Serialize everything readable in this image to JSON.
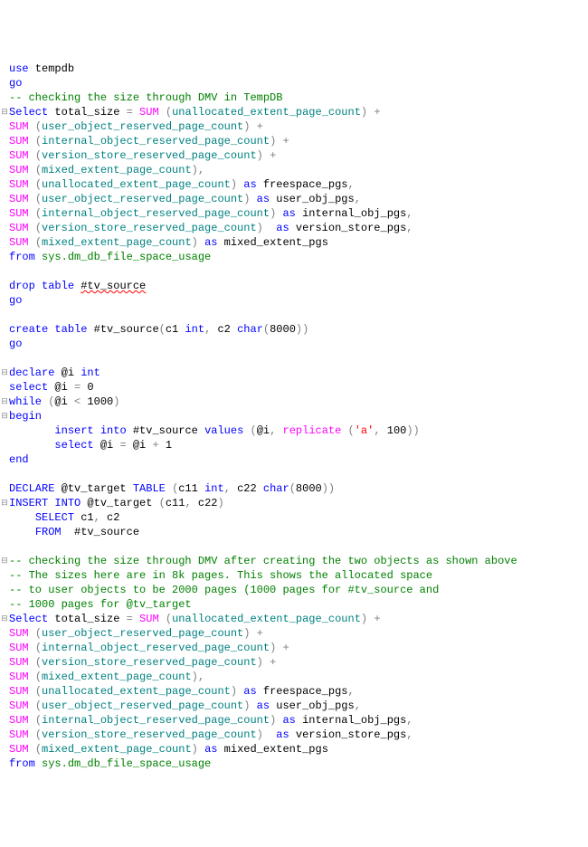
{
  "lines": [
    {
      "gutter": "",
      "parts": [
        [
          "blue",
          "use"
        ],
        [
          "black",
          " tempdb"
        ]
      ]
    },
    {
      "gutter": "",
      "parts": [
        [
          "blue",
          "go"
        ]
      ]
    },
    {
      "gutter": "",
      "parts": [
        [
          "green",
          "-- checking the size through DMV in TempDB"
        ]
      ]
    },
    {
      "gutter": "⊟",
      "parts": [
        [
          "blue",
          "Select"
        ],
        [
          "black",
          " total_size "
        ],
        [
          "gray",
          "="
        ],
        [
          "black",
          " "
        ],
        [
          "magenta",
          "SUM"
        ],
        [
          "black",
          " "
        ],
        [
          "gray",
          "("
        ],
        [
          "teal",
          "unallocated_extent_page_count"
        ],
        [
          "gray",
          ")"
        ],
        [
          "black",
          " "
        ],
        [
          "gray",
          "+"
        ]
      ]
    },
    {
      "gutter": "",
      "parts": [
        [
          "magenta",
          "SUM"
        ],
        [
          "black",
          " "
        ],
        [
          "gray",
          "("
        ],
        [
          "teal",
          "user_object_reserved_page_count"
        ],
        [
          "gray",
          ")"
        ],
        [
          "black",
          " "
        ],
        [
          "gray",
          "+"
        ]
      ]
    },
    {
      "gutter": "",
      "parts": [
        [
          "magenta",
          "SUM"
        ],
        [
          "black",
          " "
        ],
        [
          "gray",
          "("
        ],
        [
          "teal",
          "internal_object_reserved_page_count"
        ],
        [
          "gray",
          ")"
        ],
        [
          "black",
          " "
        ],
        [
          "gray",
          "+"
        ]
      ]
    },
    {
      "gutter": "",
      "parts": [
        [
          "magenta",
          "SUM"
        ],
        [
          "black",
          " "
        ],
        [
          "gray",
          "("
        ],
        [
          "teal",
          "version_store_reserved_page_count"
        ],
        [
          "gray",
          ")"
        ],
        [
          "black",
          " "
        ],
        [
          "gray",
          "+"
        ]
      ]
    },
    {
      "gutter": "",
      "parts": [
        [
          "magenta",
          "SUM"
        ],
        [
          "black",
          " "
        ],
        [
          "gray",
          "("
        ],
        [
          "teal",
          "mixed_extent_page_count"
        ],
        [
          "gray",
          ")"
        ],
        [
          "gray",
          ","
        ]
      ]
    },
    {
      "gutter": "",
      "parts": [
        [
          "magenta",
          "SUM"
        ],
        [
          "black",
          " "
        ],
        [
          "gray",
          "("
        ],
        [
          "teal",
          "unallocated_extent_page_count"
        ],
        [
          "gray",
          ")"
        ],
        [
          "black",
          " "
        ],
        [
          "blue",
          "as"
        ],
        [
          "black",
          " freespace_pgs"
        ],
        [
          "gray",
          ","
        ]
      ]
    },
    {
      "gutter": "",
      "parts": [
        [
          "magenta",
          "SUM"
        ],
        [
          "black",
          " "
        ],
        [
          "gray",
          "("
        ],
        [
          "teal",
          "user_object_reserved_page_count"
        ],
        [
          "gray",
          ")"
        ],
        [
          "black",
          " "
        ],
        [
          "blue",
          "as"
        ],
        [
          "black",
          " user_obj_pgs"
        ],
        [
          "gray",
          ","
        ]
      ]
    },
    {
      "gutter": "",
      "parts": [
        [
          "magenta",
          "SUM"
        ],
        [
          "black",
          " "
        ],
        [
          "gray",
          "("
        ],
        [
          "teal",
          "internal_object_reserved_page_count"
        ],
        [
          "gray",
          ")"
        ],
        [
          "black",
          " "
        ],
        [
          "blue",
          "as"
        ],
        [
          "black",
          " internal_obj_pgs"
        ],
        [
          "gray",
          ","
        ]
      ]
    },
    {
      "gutter": "",
      "parts": [
        [
          "magenta",
          "SUM"
        ],
        [
          "black",
          " "
        ],
        [
          "gray",
          "("
        ],
        [
          "teal",
          "version_store_reserved_page_count"
        ],
        [
          "gray",
          ")"
        ],
        [
          "black",
          "  "
        ],
        [
          "blue",
          "as"
        ],
        [
          "black",
          " version_store_pgs"
        ],
        [
          "gray",
          ","
        ]
      ]
    },
    {
      "gutter": "",
      "parts": [
        [
          "magenta",
          "SUM"
        ],
        [
          "black",
          " "
        ],
        [
          "gray",
          "("
        ],
        [
          "teal",
          "mixed_extent_page_count"
        ],
        [
          "gray",
          ")"
        ],
        [
          "black",
          " "
        ],
        [
          "blue",
          "as"
        ],
        [
          "black",
          " mixed_extent_pgs"
        ]
      ]
    },
    {
      "gutter": "",
      "parts": [
        [
          "blue",
          "from"
        ],
        [
          "black",
          " "
        ],
        [
          "green",
          "sys.dm_db_file_space_usage"
        ]
      ]
    },
    {
      "gutter": "",
      "parts": [
        [
          "black",
          ""
        ]
      ]
    },
    {
      "gutter": "",
      "parts": [
        [
          "blue",
          "drop"
        ],
        [
          "black",
          " "
        ],
        [
          "blue",
          "table"
        ],
        [
          "black",
          " "
        ],
        [
          "black_squiggle",
          "#tv_source"
        ]
      ]
    },
    {
      "gutter": "",
      "parts": [
        [
          "blue",
          "go"
        ]
      ]
    },
    {
      "gutter": "",
      "parts": [
        [
          "black",
          ""
        ]
      ]
    },
    {
      "gutter": "",
      "parts": [
        [
          "blue",
          "create"
        ],
        [
          "black",
          " "
        ],
        [
          "blue",
          "table"
        ],
        [
          "black",
          " #tv_source"
        ],
        [
          "gray",
          "("
        ],
        [
          "black",
          "c1 "
        ],
        [
          "blue",
          "int"
        ],
        [
          "gray",
          ","
        ],
        [
          "black",
          " c2 "
        ],
        [
          "blue",
          "char"
        ],
        [
          "gray",
          "("
        ],
        [
          "black",
          "8000"
        ],
        [
          "gray",
          "))"
        ]
      ]
    },
    {
      "gutter": "",
      "parts": [
        [
          "blue",
          "go"
        ]
      ]
    },
    {
      "gutter": "",
      "parts": [
        [
          "black",
          ""
        ]
      ]
    },
    {
      "gutter": "⊟",
      "parts": [
        [
          "blue",
          "declare"
        ],
        [
          "black",
          " @i "
        ],
        [
          "blue",
          "int"
        ]
      ]
    },
    {
      "gutter": "",
      "parts": [
        [
          "blue",
          "select"
        ],
        [
          "black",
          " @i "
        ],
        [
          "gray",
          "="
        ],
        [
          "black",
          " 0"
        ]
      ]
    },
    {
      "gutter": "⊟",
      "parts": [
        [
          "blue",
          "while"
        ],
        [
          "black",
          " "
        ],
        [
          "gray",
          "("
        ],
        [
          "black",
          "@i "
        ],
        [
          "gray",
          "<"
        ],
        [
          "black",
          " 1000"
        ],
        [
          "gray",
          ")"
        ]
      ]
    },
    {
      "gutter": "⊟",
      "parts": [
        [
          "blue",
          "begin"
        ]
      ]
    },
    {
      "gutter": "",
      "parts": [
        [
          "black",
          "       "
        ],
        [
          "blue",
          "insert"
        ],
        [
          "black",
          " "
        ],
        [
          "blue",
          "into"
        ],
        [
          "black",
          " #tv_source "
        ],
        [
          "blue",
          "values"
        ],
        [
          "black",
          " "
        ],
        [
          "gray",
          "("
        ],
        [
          "black",
          "@i"
        ],
        [
          "gray",
          ","
        ],
        [
          "black",
          " "
        ],
        [
          "magenta",
          "replicate"
        ],
        [
          "black",
          " "
        ],
        [
          "gray",
          "("
        ],
        [
          "red",
          "'a'"
        ],
        [
          "gray",
          ","
        ],
        [
          "black",
          " 100"
        ],
        [
          "gray",
          "))"
        ]
      ]
    },
    {
      "gutter": "",
      "parts": [
        [
          "black",
          "       "
        ],
        [
          "blue",
          "select"
        ],
        [
          "black",
          " @i "
        ],
        [
          "gray",
          "="
        ],
        [
          "black",
          " @i "
        ],
        [
          "gray",
          "+"
        ],
        [
          "black",
          " 1"
        ]
      ]
    },
    {
      "gutter": "",
      "parts": [
        [
          "blue",
          "end"
        ]
      ]
    },
    {
      "gutter": "",
      "parts": [
        [
          "black",
          ""
        ]
      ]
    },
    {
      "gutter": "",
      "parts": [
        [
          "blue",
          "DECLARE"
        ],
        [
          "black",
          " @tv_target "
        ],
        [
          "blue",
          "TABLE"
        ],
        [
          "black",
          " "
        ],
        [
          "gray",
          "("
        ],
        [
          "black",
          "c11 "
        ],
        [
          "blue",
          "int"
        ],
        [
          "gray",
          ","
        ],
        [
          "black",
          " c22 "
        ],
        [
          "blue",
          "char"
        ],
        [
          "gray",
          "("
        ],
        [
          "black",
          "8000"
        ],
        [
          "gray",
          "))"
        ]
      ]
    },
    {
      "gutter": "⊟",
      "parts": [
        [
          "blue",
          "INSERT"
        ],
        [
          "black",
          " "
        ],
        [
          "blue",
          "INTO"
        ],
        [
          "black",
          " @tv_target "
        ],
        [
          "gray",
          "("
        ],
        [
          "black",
          "c11"
        ],
        [
          "gray",
          ","
        ],
        [
          "black",
          " c22"
        ],
        [
          "gray",
          ")"
        ]
      ]
    },
    {
      "gutter": "",
      "parts": [
        [
          "black",
          "    "
        ],
        [
          "blue",
          "SELECT"
        ],
        [
          "black",
          " c1"
        ],
        [
          "gray",
          ","
        ],
        [
          "black",
          " c2"
        ]
      ]
    },
    {
      "gutter": "",
      "parts": [
        [
          "black",
          "    "
        ],
        [
          "blue",
          "FROM"
        ],
        [
          "black",
          "  #tv_source"
        ]
      ]
    },
    {
      "gutter": "",
      "parts": [
        [
          "black",
          ""
        ]
      ]
    },
    {
      "gutter": "⊟",
      "parts": [
        [
          "green",
          "-- checking the size through DMV after creating the two objects as shown above"
        ]
      ]
    },
    {
      "gutter": "",
      "parts": [
        [
          "green",
          "-- The sizes here are in 8k pages. This shows the allocated space"
        ]
      ]
    },
    {
      "gutter": "",
      "parts": [
        [
          "green",
          "-- to user objects to be 2000 pages (1000 pages for #tv_source and"
        ]
      ]
    },
    {
      "gutter": "",
      "parts": [
        [
          "green",
          "-- 1000 pages for @tv_target"
        ]
      ]
    },
    {
      "gutter": "⊟",
      "parts": [
        [
          "blue",
          "Select"
        ],
        [
          "black",
          " total_size "
        ],
        [
          "gray",
          "="
        ],
        [
          "black",
          " "
        ],
        [
          "magenta",
          "SUM"
        ],
        [
          "black",
          " "
        ],
        [
          "gray",
          "("
        ],
        [
          "teal",
          "unallocated_extent_page_count"
        ],
        [
          "gray",
          ")"
        ],
        [
          "black",
          " "
        ],
        [
          "gray",
          "+"
        ]
      ]
    },
    {
      "gutter": "",
      "parts": [
        [
          "magenta",
          "SUM"
        ],
        [
          "black",
          " "
        ],
        [
          "gray",
          "("
        ],
        [
          "teal",
          "user_object_reserved_page_count"
        ],
        [
          "gray",
          ")"
        ],
        [
          "black",
          " "
        ],
        [
          "gray",
          "+"
        ]
      ]
    },
    {
      "gutter": "",
      "parts": [
        [
          "magenta",
          "SUM"
        ],
        [
          "black",
          " "
        ],
        [
          "gray",
          "("
        ],
        [
          "teal",
          "internal_object_reserved_page_count"
        ],
        [
          "gray",
          ")"
        ],
        [
          "black",
          " "
        ],
        [
          "gray",
          "+"
        ]
      ]
    },
    {
      "gutter": "",
      "parts": [
        [
          "magenta",
          "SUM"
        ],
        [
          "black",
          " "
        ],
        [
          "gray",
          "("
        ],
        [
          "teal",
          "version_store_reserved_page_count"
        ],
        [
          "gray",
          ")"
        ],
        [
          "black",
          " "
        ],
        [
          "gray",
          "+"
        ]
      ]
    },
    {
      "gutter": "",
      "parts": [
        [
          "magenta",
          "SUM"
        ],
        [
          "black",
          " "
        ],
        [
          "gray",
          "("
        ],
        [
          "teal",
          "mixed_extent_page_count"
        ],
        [
          "gray",
          ")"
        ],
        [
          "gray",
          ","
        ]
      ]
    },
    {
      "gutter": "",
      "parts": [
        [
          "magenta",
          "SUM"
        ],
        [
          "black",
          " "
        ],
        [
          "gray",
          "("
        ],
        [
          "teal",
          "unallocated_extent_page_count"
        ],
        [
          "gray",
          ")"
        ],
        [
          "black",
          " "
        ],
        [
          "blue",
          "as"
        ],
        [
          "black",
          " freespace_pgs"
        ],
        [
          "gray",
          ","
        ]
      ]
    },
    {
      "gutter": "",
      "parts": [
        [
          "magenta",
          "SUM"
        ],
        [
          "black",
          " "
        ],
        [
          "gray",
          "("
        ],
        [
          "teal",
          "user_object_reserved_page_count"
        ],
        [
          "gray",
          ")"
        ],
        [
          "black",
          " "
        ],
        [
          "blue",
          "as"
        ],
        [
          "black",
          " user_obj_pgs"
        ],
        [
          "gray",
          ","
        ]
      ]
    },
    {
      "gutter": "",
      "parts": [
        [
          "magenta",
          "SUM"
        ],
        [
          "black",
          " "
        ],
        [
          "gray",
          "("
        ],
        [
          "teal",
          "internal_object_reserved_page_count"
        ],
        [
          "gray",
          ")"
        ],
        [
          "black",
          " "
        ],
        [
          "blue",
          "as"
        ],
        [
          "black",
          " internal_obj_pgs"
        ],
        [
          "gray",
          ","
        ]
      ]
    },
    {
      "gutter": "",
      "parts": [
        [
          "magenta",
          "SUM"
        ],
        [
          "black",
          " "
        ],
        [
          "gray",
          "("
        ],
        [
          "teal",
          "version_store_reserved_page_count"
        ],
        [
          "gray",
          ")"
        ],
        [
          "black",
          "  "
        ],
        [
          "blue",
          "as"
        ],
        [
          "black",
          " version_store_pgs"
        ],
        [
          "gray",
          ","
        ]
      ]
    },
    {
      "gutter": "",
      "parts": [
        [
          "magenta",
          "SUM"
        ],
        [
          "black",
          " "
        ],
        [
          "gray",
          "("
        ],
        [
          "teal",
          "mixed_extent_page_count"
        ],
        [
          "gray",
          ")"
        ],
        [
          "black",
          " "
        ],
        [
          "blue",
          "as"
        ],
        [
          "black",
          " mixed_extent_pgs"
        ]
      ]
    },
    {
      "gutter": "",
      "parts": [
        [
          "blue",
          "from"
        ],
        [
          "black",
          " "
        ],
        [
          "green",
          "sys.dm_db_file_space_usage"
        ]
      ]
    }
  ]
}
